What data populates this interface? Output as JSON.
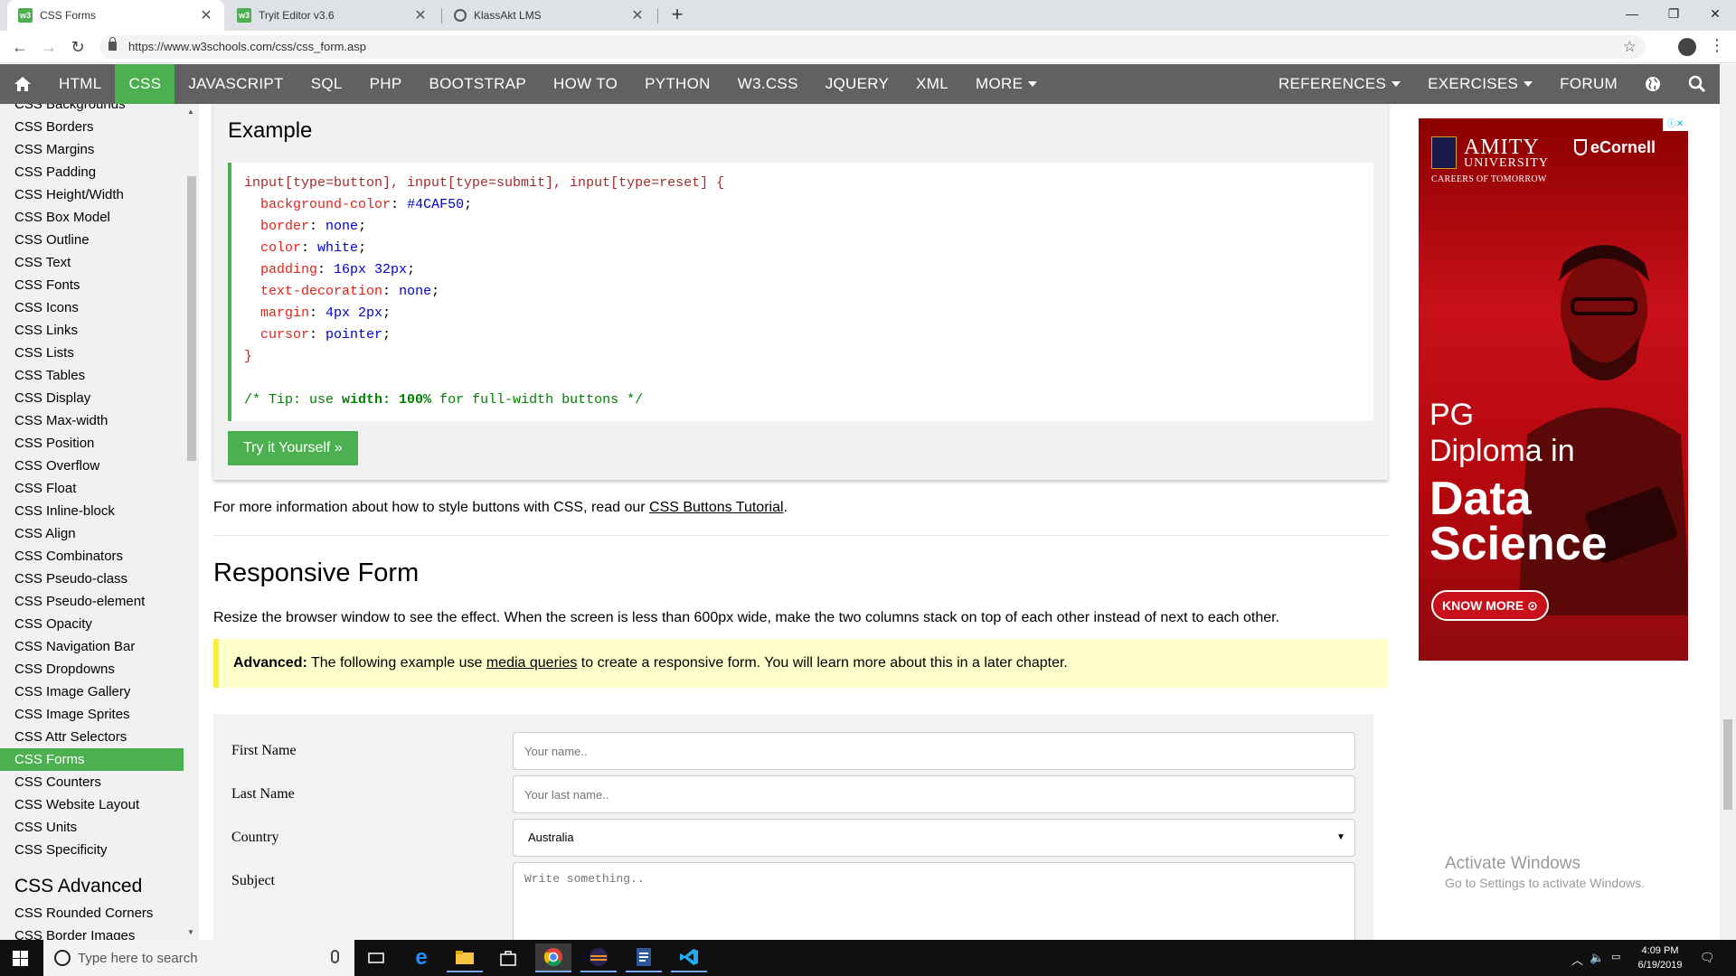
{
  "browser": {
    "tabs": [
      {
        "title": "CSS Forms",
        "icon": "w3schools-favicon",
        "active": true
      },
      {
        "title": "Tryit Editor v3.6",
        "icon": "w3schools-favicon",
        "active": false
      },
      {
        "title": "KlassAkt LMS",
        "icon": "globe-icon",
        "active": false
      }
    ],
    "tab_close": "✕",
    "new_tab": "+",
    "window_controls": {
      "minimize": "—",
      "maximize": "❐",
      "close": "✕"
    },
    "url": "https://www.w3schools.com/css/css_form.asp"
  },
  "topnav": {
    "items": [
      "HTML",
      "CSS",
      "JAVASCRIPT",
      "SQL",
      "PHP",
      "BOOTSTRAP",
      "HOW TO",
      "PYTHON",
      "W3.CSS",
      "JQUERY",
      "XML",
      "MORE"
    ],
    "active": "CSS",
    "right_items": [
      "REFERENCES",
      "EXERCISES",
      "FORUM"
    ]
  },
  "sidebar": {
    "items": [
      "CSS Backgrounds",
      "CSS Borders",
      "CSS Margins",
      "CSS Padding",
      "CSS Height/Width",
      "CSS Box Model",
      "CSS Outline",
      "CSS Text",
      "CSS Fonts",
      "CSS Icons",
      "CSS Links",
      "CSS Lists",
      "CSS Tables",
      "CSS Display",
      "CSS Max-width",
      "CSS Position",
      "CSS Overflow",
      "CSS Float",
      "CSS Inline-block",
      "CSS Align",
      "CSS Combinators",
      "CSS Pseudo-class",
      "CSS Pseudo-element",
      "CSS Opacity",
      "CSS Navigation Bar",
      "CSS Dropdowns",
      "CSS Image Gallery",
      "CSS Image Sprites",
      "CSS Attr Selectors",
      "CSS Forms",
      "CSS Counters",
      "CSS Website Layout",
      "CSS Units",
      "CSS Specificity"
    ],
    "active": "CSS Forms",
    "advanced_heading": "CSS Advanced",
    "advanced_items": [
      "CSS Rounded Corners",
      "CSS Border Images"
    ]
  },
  "example": {
    "title": "Example",
    "code": {
      "selector": "input[type=button], input[type=submit], input[type=reset] {",
      "declarations": [
        {
          "prop": "background-color",
          "val": "#4CAF50"
        },
        {
          "prop": "border",
          "val": "none"
        },
        {
          "prop": "color",
          "val": "white"
        },
        {
          "prop": "padding",
          "val": "16px 32px"
        },
        {
          "prop": "text-decoration",
          "val": "none"
        },
        {
          "prop": "margin",
          "val": "4px 2px"
        },
        {
          "prop": "cursor",
          "val": "pointer"
        }
      ],
      "close": "}",
      "comment_pre": "/* Tip: use ",
      "comment_bold": "width: 100%",
      "comment_post": " for full-width buttons */"
    },
    "try_button": "Try it Yourself »"
  },
  "content": {
    "more_info_pre": "For more information about how to style buttons with CSS, read our ",
    "more_info_link": "CSS Buttons Tutorial",
    "more_info_post": ".",
    "responsive_title": "Responsive Form",
    "resize_text": "Resize the browser window to see the effect. When the screen is less than 600px wide, make the two columns stack on top of each other instead of next to each other.",
    "advanced_label": "Advanced:",
    "advanced_pre": " The following example use ",
    "advanced_link": "media queries",
    "advanced_post": " to create a responsive form. You will learn more about this in a later chapter."
  },
  "form": {
    "first_name_label": "First Name",
    "first_name_placeholder": "Your name..",
    "last_name_label": "Last Name",
    "last_name_placeholder": "Your last name..",
    "country_label": "Country",
    "country_value": "Australia",
    "subject_label": "Subject",
    "subject_placeholder": "Write something.."
  },
  "ad": {
    "amity_name": "AMITY",
    "amity_sub": "UNIVERSITY",
    "careers": "CAREERS OF TOMORROW",
    "ecornell": "eCornell",
    "pg_line1": "PG",
    "pg_line2": "Diploma in",
    "data_line1": "Data",
    "data_line2": "Science",
    "know_more": "KNOW MORE ⊙",
    "badge": "ⓘ✕"
  },
  "watermark": {
    "title": "Activate Windows",
    "subtitle": "Go to Settings to activate Windows."
  },
  "taskbar": {
    "search_placeholder": "Type here to search",
    "time": "4:09 PM",
    "date": "6/19/2019"
  },
  "colors": {
    "w3_green": "#4caf50",
    "nav_gray": "#616161",
    "note_yellow": "#ffffcc"
  }
}
